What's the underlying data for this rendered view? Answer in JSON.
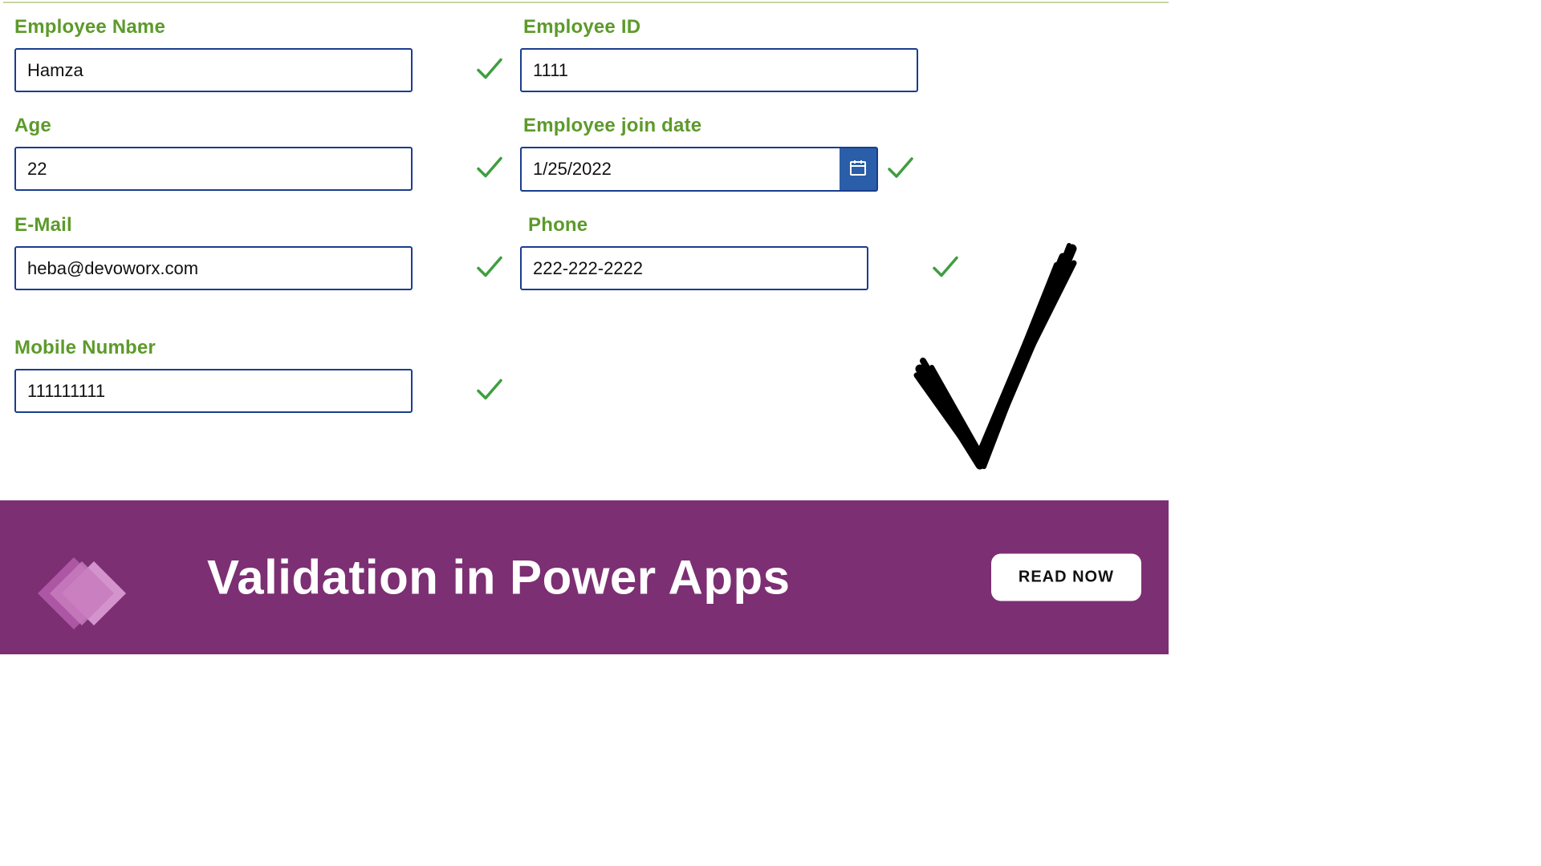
{
  "fields": {
    "employee_name": {
      "label": "Employee Name",
      "value": "Hamza"
    },
    "employee_id": {
      "label": "Employee  ID",
      "value": "1111"
    },
    "age": {
      "label": "Age",
      "value": "22"
    },
    "join_date": {
      "label": "Employee join date",
      "value": "1/25/2022"
    },
    "email": {
      "label": "E-Mail",
      "value": "heba@devoworx.com"
    },
    "phone": {
      "label": "Phone",
      "value": "222-222-2222"
    },
    "mobile": {
      "label": "Mobile Number",
      "value": "111111111"
    }
  },
  "banner": {
    "title": "Validation in Power Apps",
    "cta": "READ NOW"
  },
  "colors": {
    "label": "#5c9a2a",
    "border": "#1a3d8f",
    "check": "#3f9e3f",
    "banner_bg": "#7c2f73",
    "date_btn": "#2b5ea8"
  }
}
